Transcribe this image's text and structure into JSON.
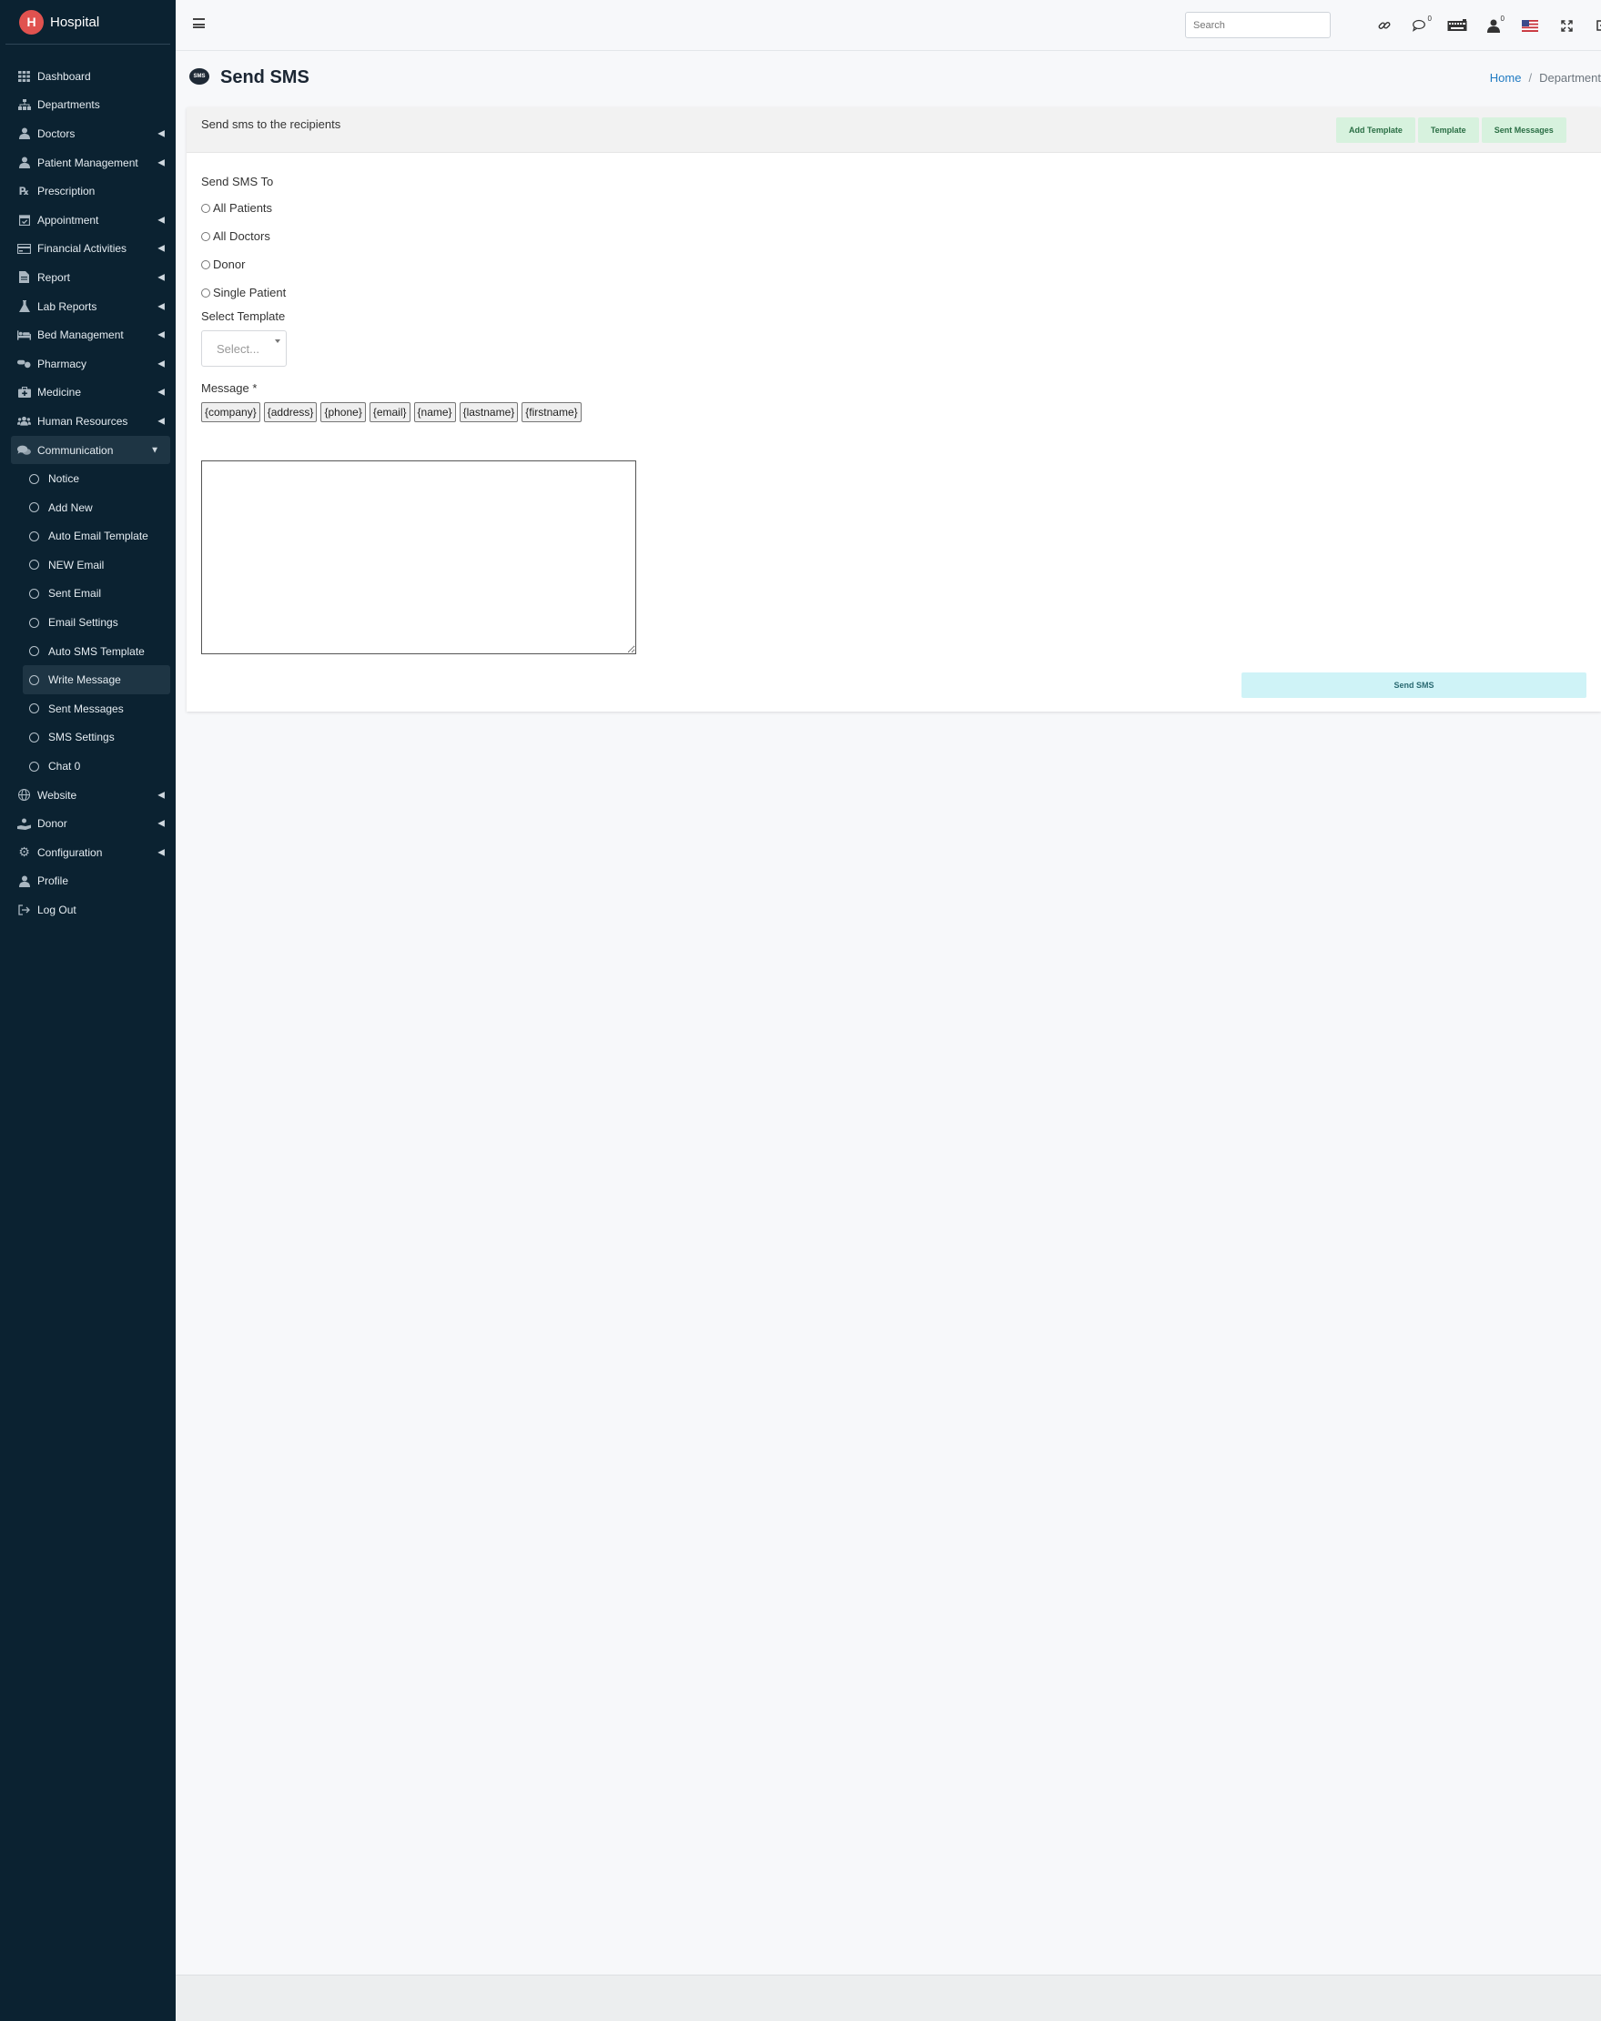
{
  "brand": {
    "name": "Hospital",
    "logo_letter": "H"
  },
  "sidebar": {
    "items": [
      {
        "label": "Dashboard",
        "icon": "grid-icon",
        "chevron": false
      },
      {
        "label": "Departments",
        "icon": "sitemap-icon",
        "chevron": false
      },
      {
        "label": "Doctors",
        "icon": "user-md-icon",
        "chevron": true
      },
      {
        "label": "Patient Management",
        "icon": "user-icon",
        "chevron": true
      },
      {
        "label": "Prescription",
        "icon": "prescription-icon",
        "chevron": false
      },
      {
        "label": "Appointment",
        "icon": "calendar-check-icon",
        "chevron": true
      },
      {
        "label": "Financial Activities",
        "icon": "money-icon",
        "chevron": true
      },
      {
        "label": "Report",
        "icon": "file-icon",
        "chevron": true
      },
      {
        "label": "Lab Reports",
        "icon": "flask-icon",
        "chevron": true
      },
      {
        "label": "Bed Management",
        "icon": "bed-icon",
        "chevron": true
      },
      {
        "label": "Pharmacy",
        "icon": "pills-icon",
        "chevron": true
      },
      {
        "label": "Medicine",
        "icon": "medkit-icon",
        "chevron": true
      },
      {
        "label": "Human Resources",
        "icon": "users-icon",
        "chevron": true
      },
      {
        "label": "Communication",
        "icon": "comments-icon",
        "chevron": true
      }
    ],
    "communication_sub": [
      "Notice",
      "Add New",
      "Auto Email Template",
      "NEW Email",
      "Sent Email",
      "Email Settings",
      "Auto SMS Template",
      "Write Message",
      "Sent Messages",
      "SMS Settings",
      "Chat 0"
    ],
    "bottom_items": [
      {
        "label": "Website",
        "icon": "globe-icon",
        "chevron": true
      },
      {
        "label": "Donor",
        "icon": "hand-holding-icon",
        "chevron": true
      },
      {
        "label": "Configuration",
        "icon": "gear-icon",
        "chevron": true
      },
      {
        "label": "Profile",
        "icon": "user-icon",
        "chevron": false
      },
      {
        "label": "Log Out",
        "icon": "sign-out-icon",
        "chevron": false
      }
    ]
  },
  "topbar": {
    "search_placeholder": "Search",
    "icons": [
      "link-icon",
      "comments-icon",
      "keyboard-icon",
      "user-icon",
      "us-flag-icon",
      "expand-icon",
      "sign-out-icon"
    ],
    "comments_badge": "0",
    "user_badge": "0"
  },
  "page": {
    "title": "Send SMS",
    "title_icon_text": "SMS",
    "breadcrumb_home": "Home",
    "breadcrumb_current": "Department"
  },
  "card": {
    "subtitle": "Send sms to the recipients",
    "add_template": "Add Template",
    "template": "Template",
    "sent_messages": "Sent Messages"
  },
  "form": {
    "send_to_label": "Send SMS To",
    "options": [
      "All Patients",
      "All Doctors",
      "Donor",
      "Single Patient"
    ],
    "select_template_label": "Select Template",
    "select_placeholder": "Select...",
    "message_label": "Message",
    "required_mark": "*",
    "tags": [
      "{company}",
      "{address}",
      "{phone}",
      "{email}",
      "{name}",
      "{lastname}",
      "{firstname}"
    ],
    "send_button": "Send SMS"
  }
}
